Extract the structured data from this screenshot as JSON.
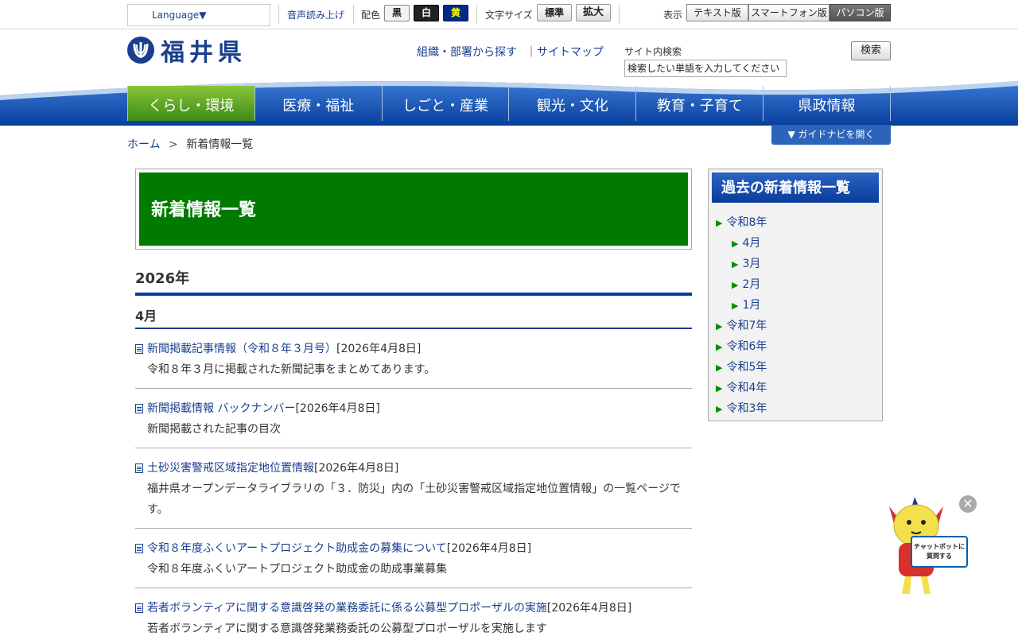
{
  "utility": {
    "language": "Language▼",
    "read_aloud": "音声読み上げ",
    "color_label": "配色",
    "color_black": "黒",
    "color_white": "白",
    "color_yellow": "黄",
    "fontsize_label": "文字サイズ",
    "fontsize_normal": "標準",
    "fontsize_large": "拡大",
    "display_label": "表示",
    "view_text": "テキスト版",
    "view_smartphone": "スマートフォン版",
    "view_pc": "パソコン版"
  },
  "header": {
    "logo_text": "福井県",
    "org_link": "組織・部署から探す",
    "separator": "｜",
    "sitemap_link": "サイトマップ",
    "search_label": "サイト内検索",
    "search_placeholder": "検索したい単語を入力してください",
    "search_button": "検索"
  },
  "nav": {
    "items": [
      "くらし・環境",
      "医療・福祉",
      "しごと・産業",
      "観光・文化",
      "教育・子育て",
      "県政情報"
    ]
  },
  "guide_button": "▼ ガイドナビを開く",
  "breadcrumb": {
    "home": "ホーム",
    "sep": ">",
    "current": "新着情報一覧"
  },
  "main": {
    "title": "新着情報一覧",
    "year": "2026年",
    "month": "4月",
    "items": [
      {
        "title": "新聞掲載記事情報（令和８年３月号）",
        "date": "[2026年4月8日]",
        "desc": "令和８年３月に掲載された新聞記事をまとめてあります。"
      },
      {
        "title": "新聞掲載情報 バックナンバー",
        "date": "[2026年4月8日]",
        "desc": "新聞掲載された記事の目次"
      },
      {
        "title": "土砂災害警戒区域指定地位置情報",
        "date": "[2026年4月8日]",
        "desc": "福井県オープンデータライブラリの「３．防災」内の「土砂災害警戒区域指定地位置情報」の一覧ページです。"
      },
      {
        "title": "令和８年度ふくいアートプロジェクト助成金の募集について",
        "date": "[2026年4月8日]",
        "desc": "令和８年度ふくいアートプロジェクト助成金の助成事業募集"
      },
      {
        "title": "若者ボランティアに関する意識啓発の業務委託に係る公募型プロポーザルの実施",
        "date": "[2026年4月8日]",
        "desc": "若者ボランティアに関する意識啓発業務委託の公募型プロポーザルを実施します"
      }
    ]
  },
  "sidebar": {
    "title": "過去の新着情報一覧",
    "items": [
      {
        "label": "令和8年"
      },
      {
        "label": "4月"
      },
      {
        "label": "3月"
      },
      {
        "label": "2月"
      },
      {
        "label": "1月"
      },
      {
        "label": "令和7年"
      },
      {
        "label": "令和6年"
      },
      {
        "label": "令和5年"
      },
      {
        "label": "令和4年"
      },
      {
        "label": "令和3年"
      }
    ]
  },
  "chatbot": {
    "close": "✕",
    "sign_line1": "チャットボットに",
    "sign_line2": "質問する"
  },
  "colors": {
    "brand_blue": "#1a3f8f",
    "nav_blue": "#0a4aa8",
    "nav_active_green": "#5aa628",
    "title_green": "#007b00"
  }
}
